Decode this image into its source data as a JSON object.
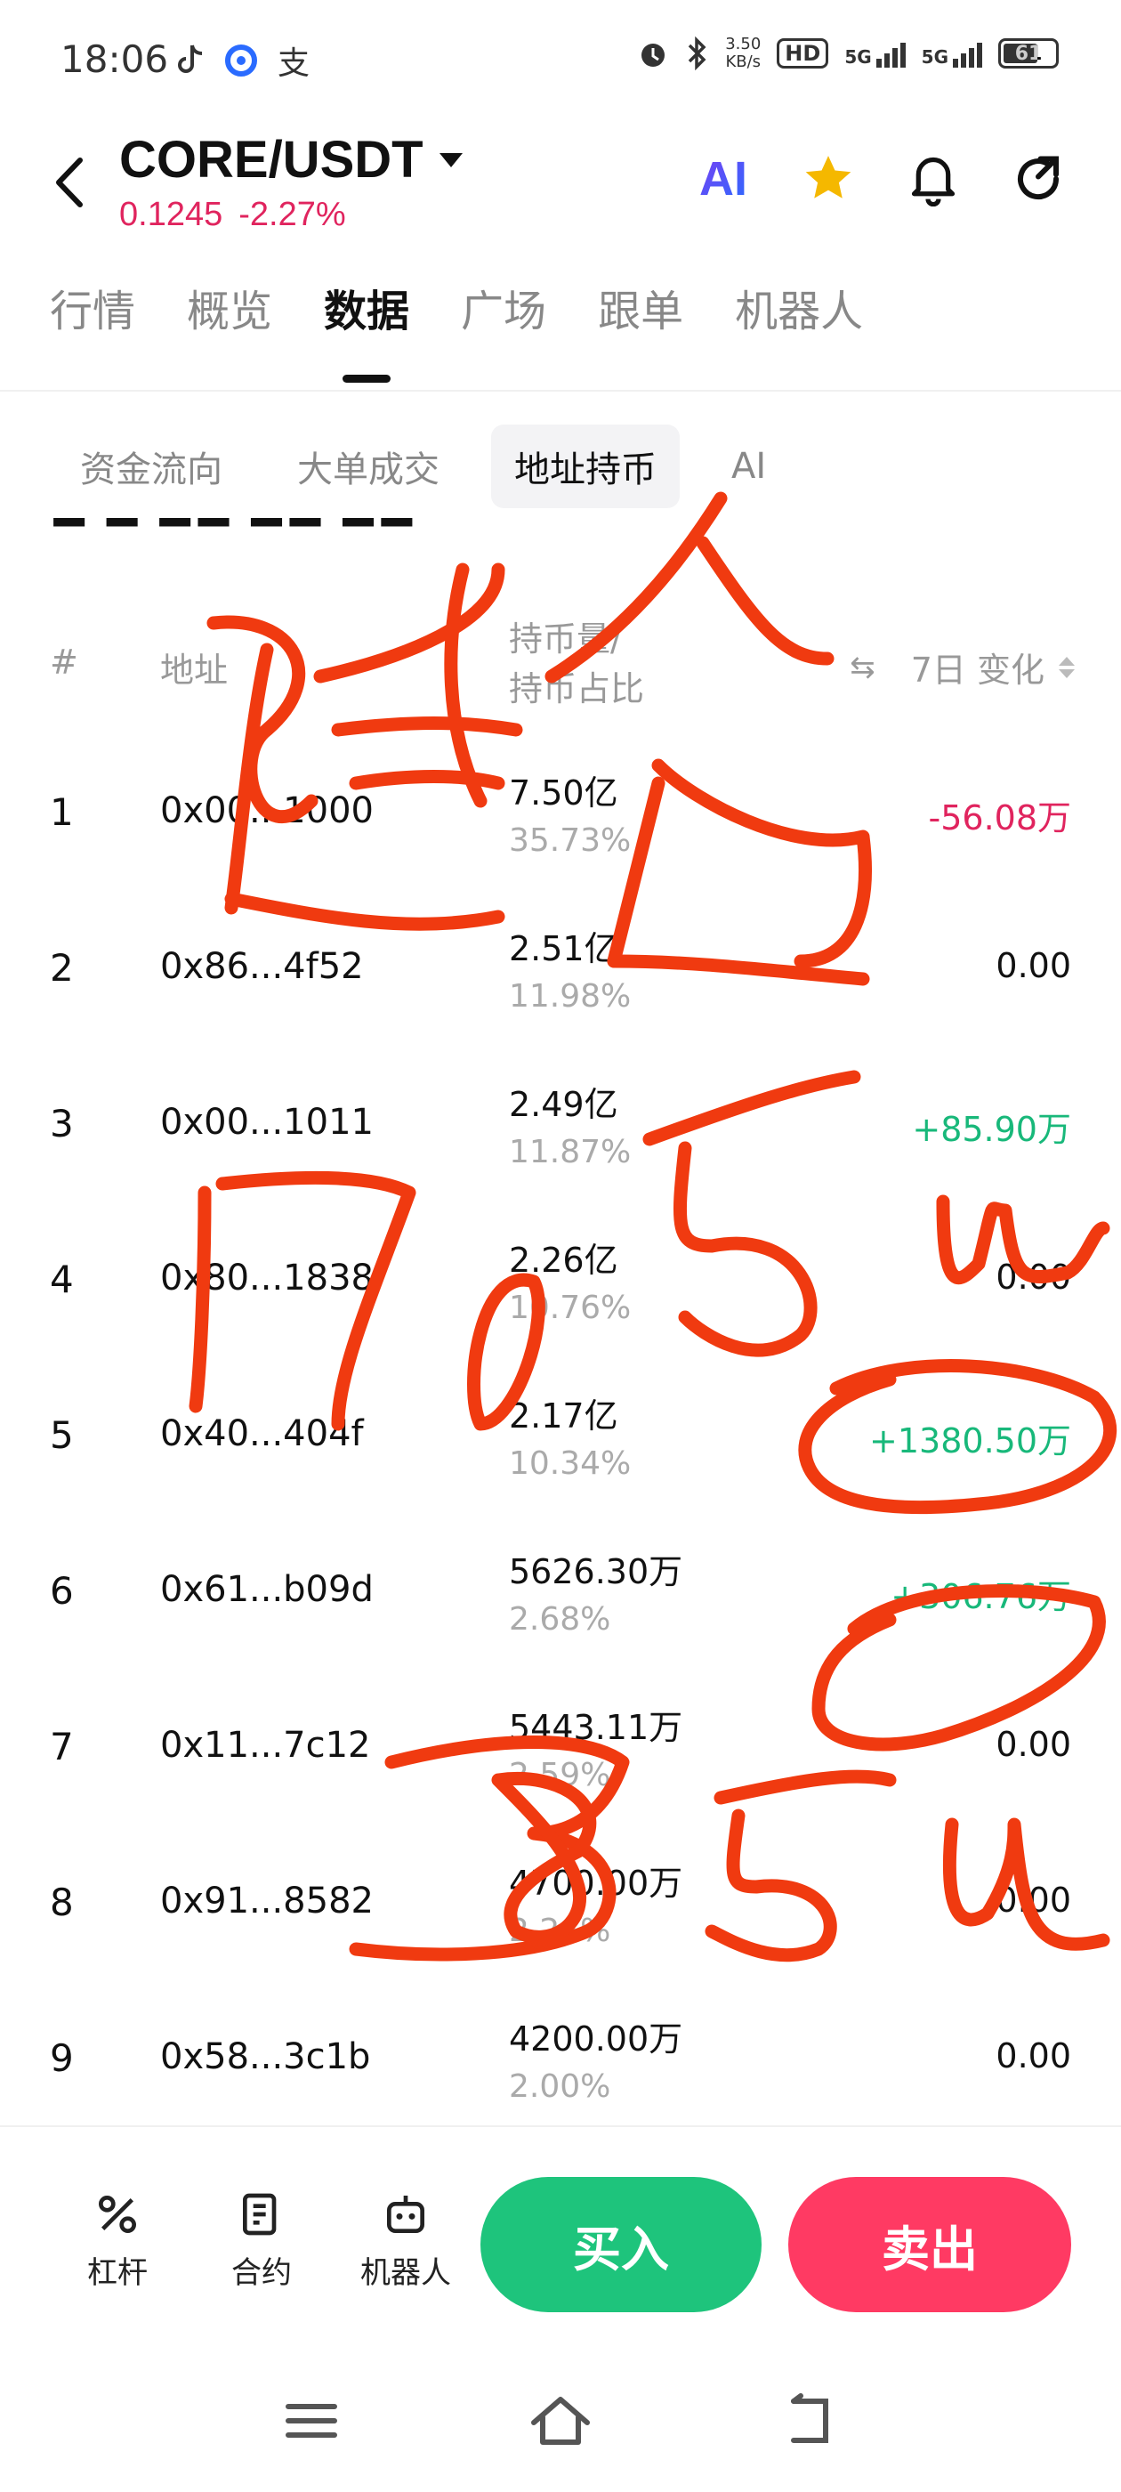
{
  "status_bar": {
    "time": "18:06",
    "apps": [
      "tiktok-icon",
      "browser-icon",
      "alipay-icon"
    ],
    "alipay_glyph": "支",
    "net_speed_value": "3.50",
    "net_speed_unit": "KB/s",
    "hd_label": "HD",
    "sim1_label": "5G",
    "sim2_label": "5G",
    "battery": "61"
  },
  "header": {
    "pair": "CORE/USDT",
    "price": "0.1245",
    "change": "-2.27%",
    "ai_label": "AI"
  },
  "main_tabs": [
    "行情",
    "概览",
    "数据",
    "广场",
    "跟单",
    "机器人"
  ],
  "main_tab_active": 2,
  "sub_tabs": [
    "资金流向",
    "大单成交",
    "地址持币",
    "AI"
  ],
  "sub_tab_active": 2,
  "table": {
    "headers": {
      "rank": "#",
      "address": "地址",
      "holding_line1": "持币量/",
      "holding_line2": "持币占比",
      "change": "7日 变化"
    },
    "rows": [
      {
        "rank": "1",
        "address": "0x00...1000",
        "amount": "7.50亿",
        "pct": "35.73%",
        "change": "-56.08万",
        "trend": "neg"
      },
      {
        "rank": "2",
        "address": "0x86...4f52",
        "amount": "2.51亿",
        "pct": "11.98%",
        "change": "0.00",
        "trend": "flat"
      },
      {
        "rank": "3",
        "address": "0x00...1011",
        "amount": "2.49亿",
        "pct": "11.87%",
        "change": "+85.90万",
        "trend": "pos"
      },
      {
        "rank": "4",
        "address": "0x80...1838",
        "amount": "2.26亿",
        "pct": "10.76%",
        "change": "0.00",
        "trend": "flat"
      },
      {
        "rank": "5",
        "address": "0x40...404f",
        "amount": "2.17亿",
        "pct": "10.34%",
        "change": "+1380.50万",
        "trend": "pos"
      },
      {
        "rank": "6",
        "address": "0x61...b09d",
        "amount": "5626.30万",
        "pct": "2.68%",
        "change": "+306.76万",
        "trend": "pos"
      },
      {
        "rank": "7",
        "address": "0x11...7c12",
        "amount": "5443.11万",
        "pct": "2.59%",
        "change": "0.00",
        "trend": "flat"
      },
      {
        "rank": "8",
        "address": "0x91...8582",
        "amount": "4700.00万",
        "pct": "2.24%",
        "change": "0.00",
        "trend": "flat"
      },
      {
        "rank": "9",
        "address": "0x58...3c1b",
        "amount": "4200.00万",
        "pct": "2.00%",
        "change": "0.00",
        "trend": "flat"
      }
    ]
  },
  "bottom_bar": {
    "items": [
      "杠杆",
      "合约",
      "机器人"
    ],
    "buy": "买入",
    "sell": "卖出"
  },
  "handwriting": {
    "line1": "建仓",
    "line2": "1705u",
    "line3": "385u"
  },
  "colors": {
    "negative": "#e0245e",
    "positive": "#18b87a",
    "buy": "#1ec47c",
    "sell": "#ff3a63",
    "ink": "#f03a10"
  }
}
